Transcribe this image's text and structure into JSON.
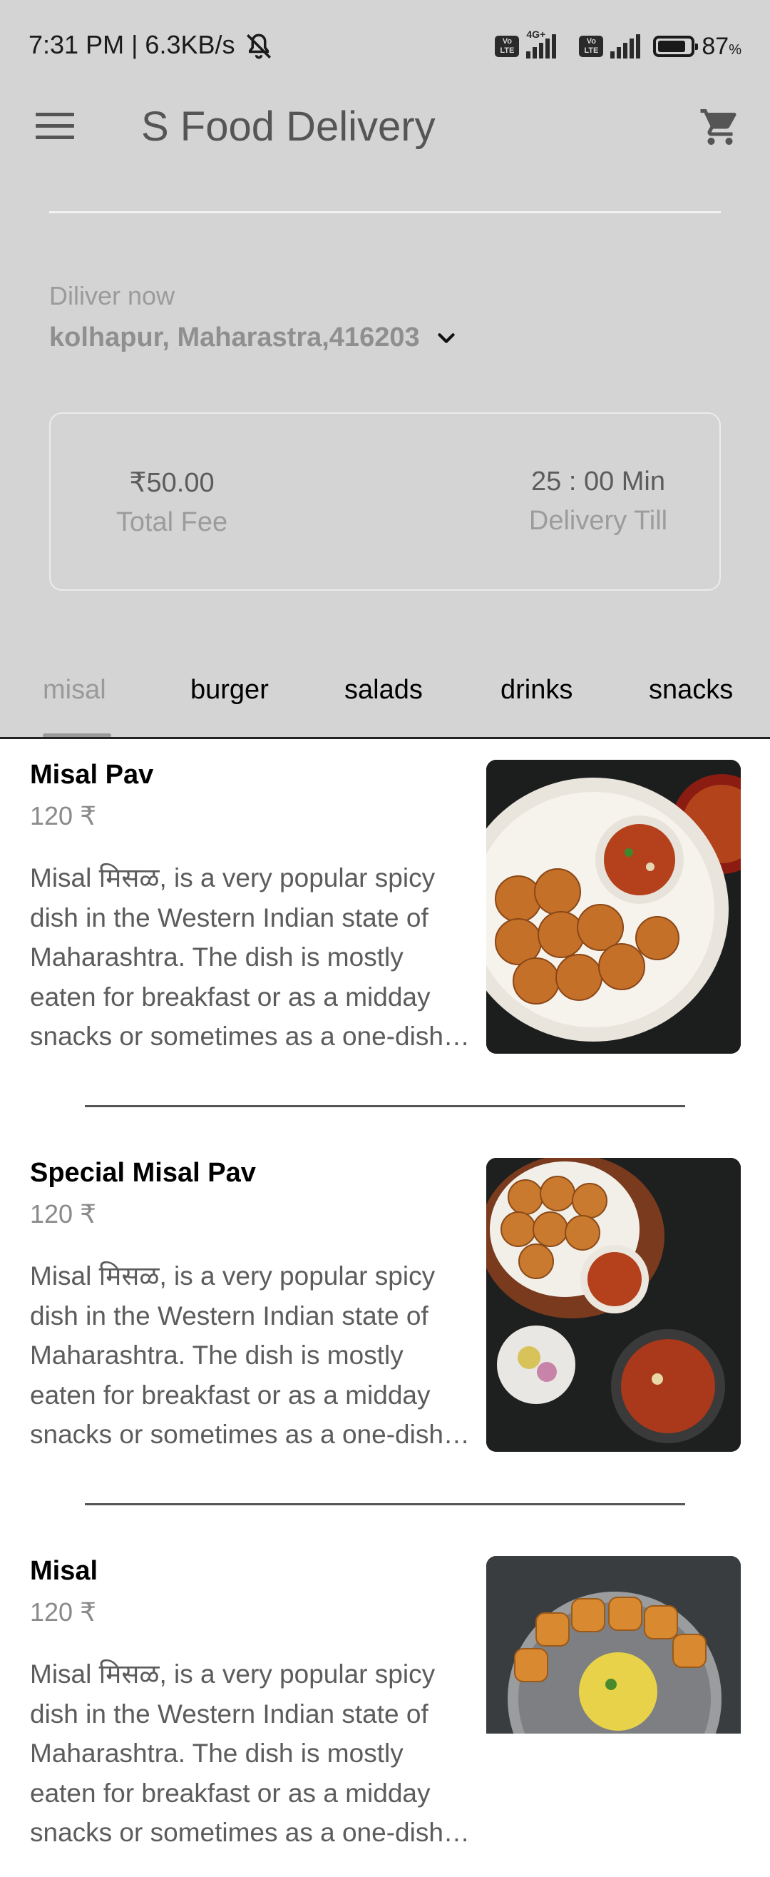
{
  "status_bar": {
    "time": "7:31 PM | 6.3KB/s",
    "network_tag": "4G+",
    "volte_label": "Vo LTE",
    "battery_percent": "87",
    "battery_unit": "%",
    "battery_level": 0.87
  },
  "app_bar": {
    "title": "S Food Delivery",
    "menu_icon": "menu-icon",
    "cart_icon": "cart-icon"
  },
  "delivery": {
    "label": "Diliver now",
    "address": "kolhapur, Maharastra,416203"
  },
  "fee_card": {
    "fee_value": "₹50.00",
    "fee_label": "Total Fee",
    "time_value": "25 : 00 Min",
    "time_label": "Delivery Till"
  },
  "tabs": [
    "misal",
    "burger",
    "salads",
    "drinks",
    "snacks"
  ],
  "active_tab": "misal",
  "items": [
    {
      "name": "Misal Pav",
      "price": "120 ₹",
      "description": "Misal मिसळ, is a very popular spicy dish in the Western Indian state of Maharashtra. The dish is mostly eaten for breakfast or as a midday snacks or sometimes as a one-dish meal"
    },
    {
      "name": "Special Misal Pav",
      "price": "120 ₹",
      "description": "Misal मिसळ, is a very popular spicy dish in the Western Indian state of Maharashtra. The dish is mostly eaten for breakfast or as a midday snacks or sometimes as a one-dish meal"
    },
    {
      "name": "Misal",
      "price": "120 ₹",
      "description": "Misal मिसळ, is a very popular spicy dish in the Western Indian state of Maharashtra. The dish is mostly eaten for breakfast or as a midday snacks or sometimes as a one-dish meal"
    }
  ],
  "colors": {
    "header_bg": "#d4d4d4",
    "muted_text": "#9b9b9b",
    "body_bg": "#ffffff"
  }
}
